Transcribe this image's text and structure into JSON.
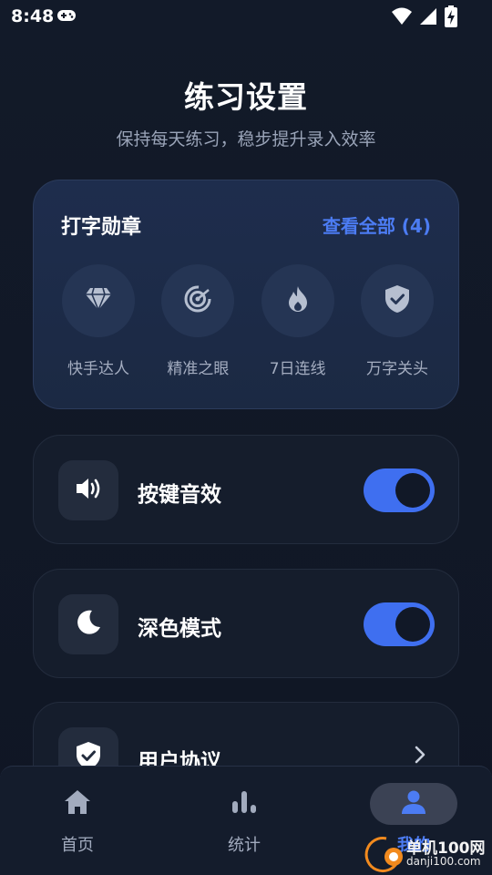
{
  "status_bar": {
    "time": "8:48"
  },
  "header": {
    "title": "练习设置",
    "subtitle": "保持每天练习，稳步提升录入效率"
  },
  "badges": {
    "title": "打字勋章",
    "view_all": "查看全部 (4)",
    "items": [
      {
        "label": "快手达人",
        "icon": "diamond-icon"
      },
      {
        "label": "精准之眼",
        "icon": "target-icon"
      },
      {
        "label": "7日连线",
        "icon": "flame-icon"
      },
      {
        "label": "万字关头",
        "icon": "shield-check-icon"
      }
    ]
  },
  "settings": {
    "key_sound": {
      "label": "按键音效",
      "icon": "speaker-icon",
      "enabled": true
    },
    "dark_mode": {
      "label": "深色模式",
      "icon": "moon-icon",
      "enabled": true
    },
    "user_agreement": {
      "label": "用户协议",
      "icon": "shield-check-icon"
    }
  },
  "bottom_nav": {
    "items": [
      {
        "label": "首页",
        "icon": "home-icon",
        "active": false
      },
      {
        "label": "统计",
        "icon": "bar-chart-icon",
        "active": false
      },
      {
        "label": "我的",
        "icon": "user-icon",
        "active": true
      }
    ]
  },
  "watermark": {
    "text": "单机100网",
    "url": "danji100.com"
  },
  "colors": {
    "accent": "#4c7cf3",
    "toggle_on": "#3f6ff0",
    "background": "#111827",
    "card": "#151d2c",
    "badge_card": "#1e2d4d"
  }
}
